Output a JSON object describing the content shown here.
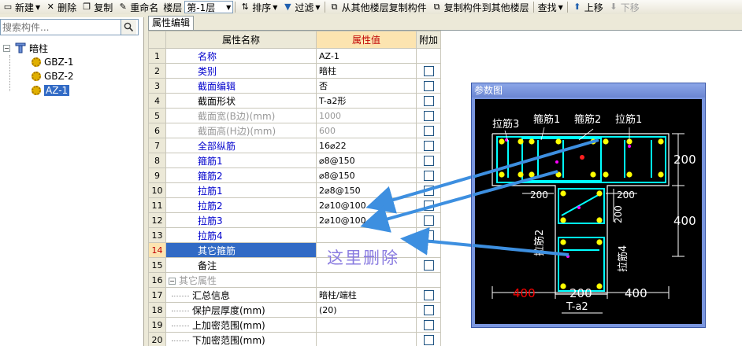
{
  "toolbar": {
    "new": "新建",
    "delete": "删除",
    "copy": "复制",
    "rename": "重命名",
    "floor_label": "楼层",
    "floor_value": "第-1层",
    "sort": "排序",
    "filter": "过滤",
    "copy_from_other": "从其他楼层复制构件",
    "copy_to_other": "复制构件到其他楼层",
    "find": "查找",
    "move_up": "上移",
    "move_down": "下移"
  },
  "left": {
    "search_placeholder": "搜索构件...",
    "tree_root": "暗柱",
    "tree_items": [
      "GBZ-1",
      "GBZ-2",
      "AZ-1"
    ]
  },
  "panel": {
    "tab": "属性编辑",
    "col_name": "属性名称",
    "col_value": "属性值",
    "col_extra": "附加"
  },
  "rows": [
    {
      "n": "1",
      "name": "名称",
      "value": "AZ-1"
    },
    {
      "n": "2",
      "name": "类别",
      "value": "暗柱"
    },
    {
      "n": "3",
      "name": "截面编辑",
      "value": "否"
    },
    {
      "n": "4",
      "name": "截面形状",
      "value": "T-a2形"
    },
    {
      "n": "5",
      "name": "截面宽(B边)(mm)",
      "value": "1000"
    },
    {
      "n": "6",
      "name": "截面高(H边)(mm)",
      "value": "600"
    },
    {
      "n": "7",
      "name": "全部纵筋",
      "value": "16⌀22"
    },
    {
      "n": "8",
      "name": "箍筋1",
      "value": "⌀8@150"
    },
    {
      "n": "9",
      "name": "箍筋2",
      "value": "⌀8@150"
    },
    {
      "n": "10",
      "name": "拉筋1",
      "value": "2⌀8@150"
    },
    {
      "n": "11",
      "name": "拉筋2",
      "value": "2⌀10@100"
    },
    {
      "n": "12",
      "name": "拉筋3",
      "value": "2⌀10@100"
    },
    {
      "n": "13",
      "name": "拉筋4",
      "value": ""
    },
    {
      "n": "14",
      "name": "其它箍筋",
      "value": ""
    },
    {
      "n": "15",
      "name": "备注",
      "value": ""
    },
    {
      "n": "16",
      "name": "其它属性",
      "value": ""
    },
    {
      "n": "17",
      "name": "汇总信息",
      "value": "暗柱/端柱"
    },
    {
      "n": "18",
      "name": "保护层厚度(mm)",
      "value": "(20)"
    },
    {
      "n": "19",
      "name": "上加密范围(mm)",
      "value": ""
    },
    {
      "n": "20",
      "name": "下加密范围(mm)",
      "value": ""
    }
  ],
  "annotation": "这里删除",
  "reference": {
    "title": "参数图",
    "labels": {
      "la3": "拉筋3",
      "gu1": "箍筋1",
      "gu2": "箍筋2",
      "la1": "拉筋1",
      "la2": "拉筋2",
      "la4": "拉筋4",
      "dim_200_right": "200",
      "dim_400_right": "400",
      "dim_200_mid": "200",
      "dim_200_mid2": "200",
      "dim_200_vert": "200",
      "dim_400_left": "400",
      "dim_200_bottom": "200",
      "dim_400_bottom": "400",
      "shape": "T-a2"
    },
    "colors": {
      "bar": "#00ffff",
      "stirrup": "#40e0e0",
      "rebar": "#ffff00",
      "dim": "#ffffff",
      "dim_red": "#ff0000",
      "tie_point": "#ff00ff",
      "arrow": "#3d8fe0"
    }
  }
}
